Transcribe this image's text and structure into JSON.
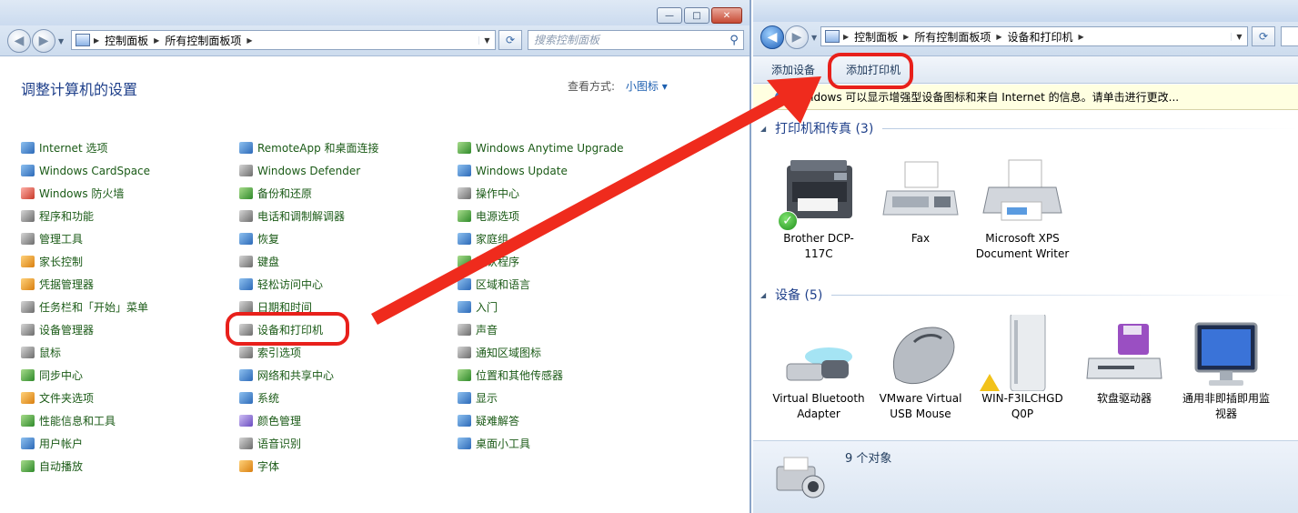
{
  "left_window": {
    "controls": {
      "minimize": "—",
      "maximize": "□",
      "close": "✕"
    },
    "address": [
      "控制面板",
      "所有控制面板项"
    ],
    "search_placeholder": "搜索控制面板",
    "page_title": "调整计算机的设置",
    "view_by_label": "查看方式:",
    "view_by_value": "小图标",
    "columns": [
      [
        "Internet 选项",
        "Windows CardSpace",
        "Windows 防火墙",
        "程序和功能",
        "管理工具",
        "家长控制",
        "凭据管理器",
        "任务栏和「开始」菜单",
        "设备管理器",
        "鼠标",
        "同步中心",
        "文件夹选项",
        "性能信息和工具",
        "用户帐户",
        "自动播放"
      ],
      [
        "RemoteApp 和桌面连接",
        "Windows Defender",
        "备份和还原",
        "电话和调制解调器",
        "恢复",
        "键盘",
        "轻松访问中心",
        "日期和时间",
        "设备和打印机",
        "索引选项",
        "网络和共享中心",
        "系统",
        "颜色管理",
        "语音识别",
        "字体"
      ],
      [
        "Windows Anytime Upgrade",
        "Windows Update",
        "操作中心",
        "电源选项",
        "家庭组",
        "默认程序",
        "区域和语言",
        "入门",
        "声音",
        "通知区域图标",
        "位置和其他传感器",
        "显示",
        "疑难解答",
        "桌面小工具"
      ]
    ]
  },
  "right_window": {
    "address": [
      "控制面板",
      "所有控制面板项",
      "设备和打印机"
    ],
    "toolbar": {
      "add_device": "添加设备",
      "add_printer": "添加打印机"
    },
    "info_bar": "Windows 可以显示增强型设备图标和来自 Internet 的信息。请单击进行更改...",
    "printers_group": "打印机和传真 (3)",
    "printers": [
      "Brother DCP-117C",
      "Fax",
      "Microsoft XPS Document Writer"
    ],
    "devices_group": "设备 (5)",
    "devices": [
      "Virtual Bluetooth Adapter",
      "VMware Virtual USB Mouse",
      "WIN-F3ILCHGD Q0P",
      "软盘驱动器",
      "通用非即插即用监视器"
    ],
    "status": "9 个对象"
  },
  "colors": {
    "highlight": "#e8201b",
    "link_green": "#1a5a16",
    "title_blue": "#1e3f8a"
  }
}
